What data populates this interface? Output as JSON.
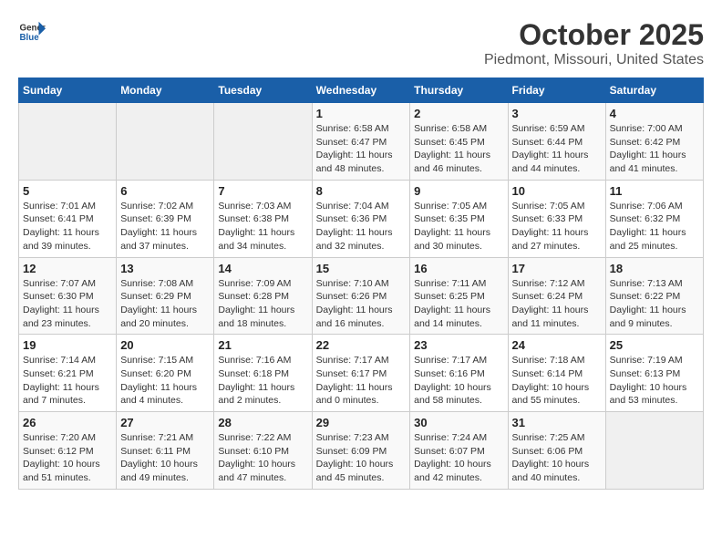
{
  "logo": {
    "line1": "General",
    "line2": "Blue"
  },
  "title": "October 2025",
  "subtitle": "Piedmont, Missouri, United States",
  "weekdays": [
    "Sunday",
    "Monday",
    "Tuesday",
    "Wednesday",
    "Thursday",
    "Friday",
    "Saturday"
  ],
  "weeks": [
    [
      {
        "day": "",
        "info": ""
      },
      {
        "day": "",
        "info": ""
      },
      {
        "day": "",
        "info": ""
      },
      {
        "day": "1",
        "info": "Sunrise: 6:58 AM\nSunset: 6:47 PM\nDaylight: 11 hours and 48 minutes."
      },
      {
        "day": "2",
        "info": "Sunrise: 6:58 AM\nSunset: 6:45 PM\nDaylight: 11 hours and 46 minutes."
      },
      {
        "day": "3",
        "info": "Sunrise: 6:59 AM\nSunset: 6:44 PM\nDaylight: 11 hours and 44 minutes."
      },
      {
        "day": "4",
        "info": "Sunrise: 7:00 AM\nSunset: 6:42 PM\nDaylight: 11 hours and 41 minutes."
      }
    ],
    [
      {
        "day": "5",
        "info": "Sunrise: 7:01 AM\nSunset: 6:41 PM\nDaylight: 11 hours and 39 minutes."
      },
      {
        "day": "6",
        "info": "Sunrise: 7:02 AM\nSunset: 6:39 PM\nDaylight: 11 hours and 37 minutes."
      },
      {
        "day": "7",
        "info": "Sunrise: 7:03 AM\nSunset: 6:38 PM\nDaylight: 11 hours and 34 minutes."
      },
      {
        "day": "8",
        "info": "Sunrise: 7:04 AM\nSunset: 6:36 PM\nDaylight: 11 hours and 32 minutes."
      },
      {
        "day": "9",
        "info": "Sunrise: 7:05 AM\nSunset: 6:35 PM\nDaylight: 11 hours and 30 minutes."
      },
      {
        "day": "10",
        "info": "Sunrise: 7:05 AM\nSunset: 6:33 PM\nDaylight: 11 hours and 27 minutes."
      },
      {
        "day": "11",
        "info": "Sunrise: 7:06 AM\nSunset: 6:32 PM\nDaylight: 11 hours and 25 minutes."
      }
    ],
    [
      {
        "day": "12",
        "info": "Sunrise: 7:07 AM\nSunset: 6:30 PM\nDaylight: 11 hours and 23 minutes."
      },
      {
        "day": "13",
        "info": "Sunrise: 7:08 AM\nSunset: 6:29 PM\nDaylight: 11 hours and 20 minutes."
      },
      {
        "day": "14",
        "info": "Sunrise: 7:09 AM\nSunset: 6:28 PM\nDaylight: 11 hours and 18 minutes."
      },
      {
        "day": "15",
        "info": "Sunrise: 7:10 AM\nSunset: 6:26 PM\nDaylight: 11 hours and 16 minutes."
      },
      {
        "day": "16",
        "info": "Sunrise: 7:11 AM\nSunset: 6:25 PM\nDaylight: 11 hours and 14 minutes."
      },
      {
        "day": "17",
        "info": "Sunrise: 7:12 AM\nSunset: 6:24 PM\nDaylight: 11 hours and 11 minutes."
      },
      {
        "day": "18",
        "info": "Sunrise: 7:13 AM\nSunset: 6:22 PM\nDaylight: 11 hours and 9 minutes."
      }
    ],
    [
      {
        "day": "19",
        "info": "Sunrise: 7:14 AM\nSunset: 6:21 PM\nDaylight: 11 hours and 7 minutes."
      },
      {
        "day": "20",
        "info": "Sunrise: 7:15 AM\nSunset: 6:20 PM\nDaylight: 11 hours and 4 minutes."
      },
      {
        "day": "21",
        "info": "Sunrise: 7:16 AM\nSunset: 6:18 PM\nDaylight: 11 hours and 2 minutes."
      },
      {
        "day": "22",
        "info": "Sunrise: 7:17 AM\nSunset: 6:17 PM\nDaylight: 11 hours and 0 minutes."
      },
      {
        "day": "23",
        "info": "Sunrise: 7:17 AM\nSunset: 6:16 PM\nDaylight: 10 hours and 58 minutes."
      },
      {
        "day": "24",
        "info": "Sunrise: 7:18 AM\nSunset: 6:14 PM\nDaylight: 10 hours and 55 minutes."
      },
      {
        "day": "25",
        "info": "Sunrise: 7:19 AM\nSunset: 6:13 PM\nDaylight: 10 hours and 53 minutes."
      }
    ],
    [
      {
        "day": "26",
        "info": "Sunrise: 7:20 AM\nSunset: 6:12 PM\nDaylight: 10 hours and 51 minutes."
      },
      {
        "day": "27",
        "info": "Sunrise: 7:21 AM\nSunset: 6:11 PM\nDaylight: 10 hours and 49 minutes."
      },
      {
        "day": "28",
        "info": "Sunrise: 7:22 AM\nSunset: 6:10 PM\nDaylight: 10 hours and 47 minutes."
      },
      {
        "day": "29",
        "info": "Sunrise: 7:23 AM\nSunset: 6:09 PM\nDaylight: 10 hours and 45 minutes."
      },
      {
        "day": "30",
        "info": "Sunrise: 7:24 AM\nSunset: 6:07 PM\nDaylight: 10 hours and 42 minutes."
      },
      {
        "day": "31",
        "info": "Sunrise: 7:25 AM\nSunset: 6:06 PM\nDaylight: 10 hours and 40 minutes."
      },
      {
        "day": "",
        "info": ""
      }
    ]
  ]
}
